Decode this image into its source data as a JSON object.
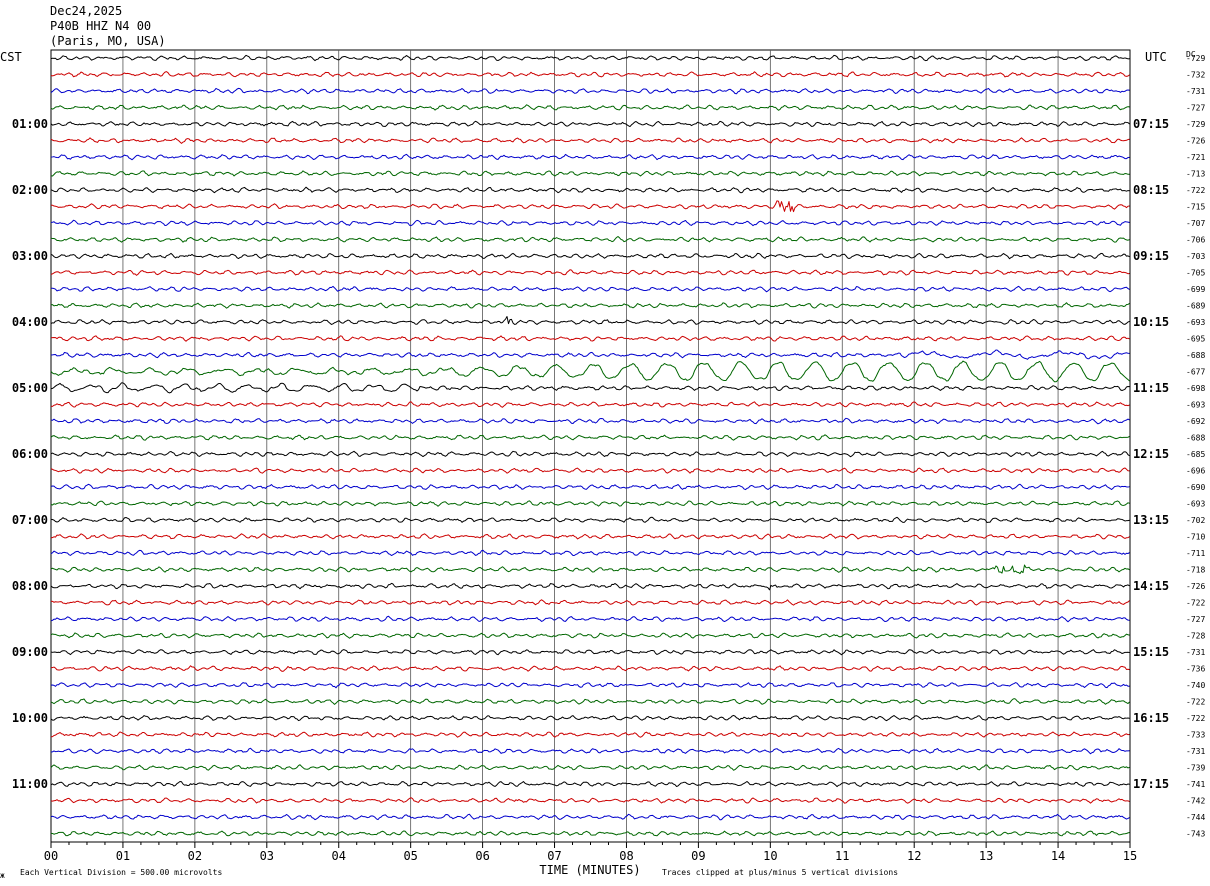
{
  "header": {
    "date": "Dec24,2025",
    "station": "P40B HHZ N4 00",
    "location": "(Paris, MO, USA)"
  },
  "chart_data": {
    "type": "line",
    "title": "P40B HHZ N4 00",
    "xlabel": "TIME (MINUTES)",
    "xlim": [
      0,
      15
    ],
    "x_ticks": [
      "00",
      "01",
      "02",
      "03",
      "04",
      "05",
      "06",
      "07",
      "08",
      "09",
      "10",
      "11",
      "12",
      "13",
      "14",
      "15"
    ],
    "left_axis_title": "CST",
    "right_axis_title": "UTC",
    "dc_label": "DC",
    "left_hour_labels": [
      "01:00",
      "02:00",
      "03:00",
      "04:00",
      "05:00",
      "06:00",
      "07:00",
      "08:00",
      "09:00",
      "10:00",
      "11:00"
    ],
    "right_hour_labels": [
      "07:15",
      "08:15",
      "09:15",
      "10:15",
      "11:15",
      "12:15",
      "13:15",
      "14:15",
      "15:15",
      "16:15",
      "17:15"
    ],
    "dc_offsets": [
      "-729",
      "-732",
      "-731",
      "-727",
      "-729",
      "-726",
      "-721",
      "-713",
      "-722",
      "-715",
      "-707",
      "-706",
      "-703",
      "-705",
      "-699",
      "-689",
      "-693",
      "-695",
      "-688",
      "-677",
      "-698",
      "-693",
      "-692",
      "-688",
      "-685",
      "-696",
      "-690",
      "-693",
      "-702",
      "-710",
      "-711",
      "-718",
      "-726",
      "-722",
      "-727",
      "-728",
      "-731",
      "-736",
      "-740",
      "-722",
      "-722",
      "-733",
      "-731",
      "-739",
      "-741",
      "-742",
      "-744",
      "-743"
    ],
    "trace_colors": [
      "#000000",
      "#cc0000",
      "#0000cc",
      "#006600"
    ],
    "rows_per_hour": 4,
    "row_count": 48,
    "grid": true,
    "footer_scale": "Each Vertical Division =  500.00 microvolts",
    "footer_clip": "Traces clipped at plus/minus 5 vertical divisions",
    "corner_mark": "ж"
  }
}
